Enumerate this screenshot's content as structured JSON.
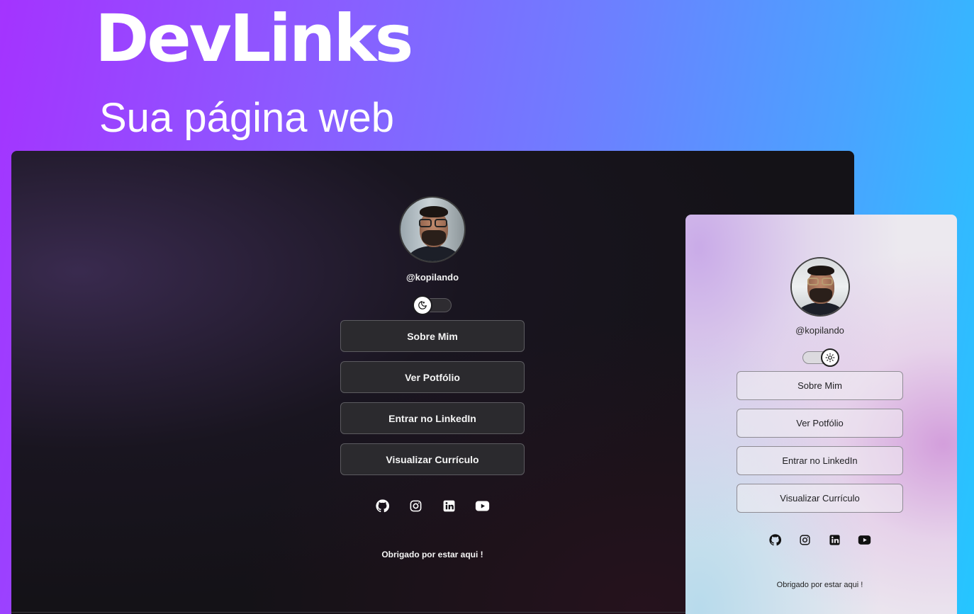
{
  "hero": {
    "title": "DevLinks",
    "subtitle": "Sua página web"
  },
  "dark_preview": {
    "theme": "dark",
    "username": "@kopilando",
    "toggle_icon": "moon-icon",
    "links": [
      {
        "label": "Sobre Mim"
      },
      {
        "label": "Ver Potfólio"
      },
      {
        "label": "Entrar no LinkedIn"
      },
      {
        "label": "Visualizar Currículo"
      }
    ],
    "socials": [
      "github-icon",
      "instagram-icon",
      "linkedin-icon",
      "youtube-icon"
    ],
    "footer": "Obrigado por estar aqui !"
  },
  "light_preview": {
    "theme": "light",
    "username": "@kopilando",
    "toggle_icon": "sun-icon",
    "links": [
      {
        "label": "Sobre Mim"
      },
      {
        "label": "Ver Potfólio"
      },
      {
        "label": "Entrar no LinkedIn"
      },
      {
        "label": "Visualizar Currículo"
      }
    ],
    "socials": [
      "github-icon",
      "instagram-icon",
      "linkedin-icon",
      "youtube-icon"
    ],
    "footer": "Obrigado por estar aqui !"
  },
  "colors": {
    "gradient_start": "#a433ff",
    "gradient_end": "#25c6ff",
    "dark_bg": "#141217",
    "dark_button": "#2b2a2e",
    "light_bg": "#ece9ef"
  }
}
